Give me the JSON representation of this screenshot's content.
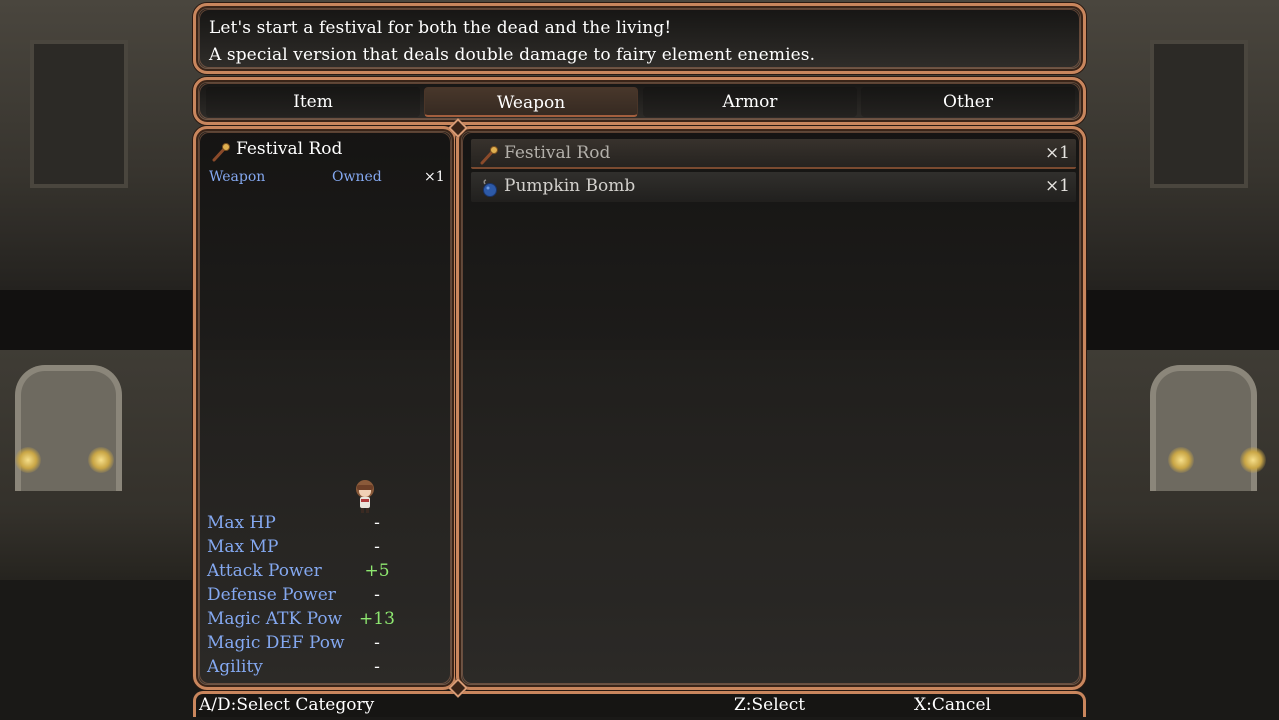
{
  "help": {
    "line1": "Let's start a festival for both the dead and the living!",
    "line2": "A special version that deals double damage to fairy element enemies."
  },
  "categories": {
    "selected_index": 1,
    "tabs": [
      {
        "label": "Item"
      },
      {
        "label": "Weapon"
      },
      {
        "label": "Armor"
      },
      {
        "label": "Other"
      }
    ]
  },
  "status": {
    "item_name": "Festival Rod",
    "item_icon": "rod-icon",
    "type_label": "Weapon",
    "owned_label": "Owned",
    "owned_count": "×1",
    "actor_icon": "character-sprite",
    "stats": [
      {
        "label": "Max HP",
        "value": "-"
      },
      {
        "label": "Max MP",
        "value": "-"
      },
      {
        "label": "Attack Power",
        "value": "+5",
        "increase": true
      },
      {
        "label": "Defense Power",
        "value": "-"
      },
      {
        "label": "Magic ATK Pow",
        "value": "+13",
        "increase": true
      },
      {
        "label": "Magic DEF Pow",
        "value": "-"
      },
      {
        "label": "Agility",
        "value": "-"
      }
    ]
  },
  "items": [
    {
      "name": "Festival Rod",
      "count": "×1",
      "icon": "rod-icon",
      "selected": true
    },
    {
      "name": "Pumpkin Bomb",
      "count": "×1",
      "icon": "bomb-icon",
      "selected": false
    }
  ],
  "footer": {
    "category_hint": "A/D:Select Category",
    "select_hint": "Z:Select",
    "cancel_hint": "X:Cancel"
  },
  "colors": {
    "frame": "#c9865d",
    "system_blue": "#84a8f0",
    "power_up_green": "#8ee870"
  }
}
